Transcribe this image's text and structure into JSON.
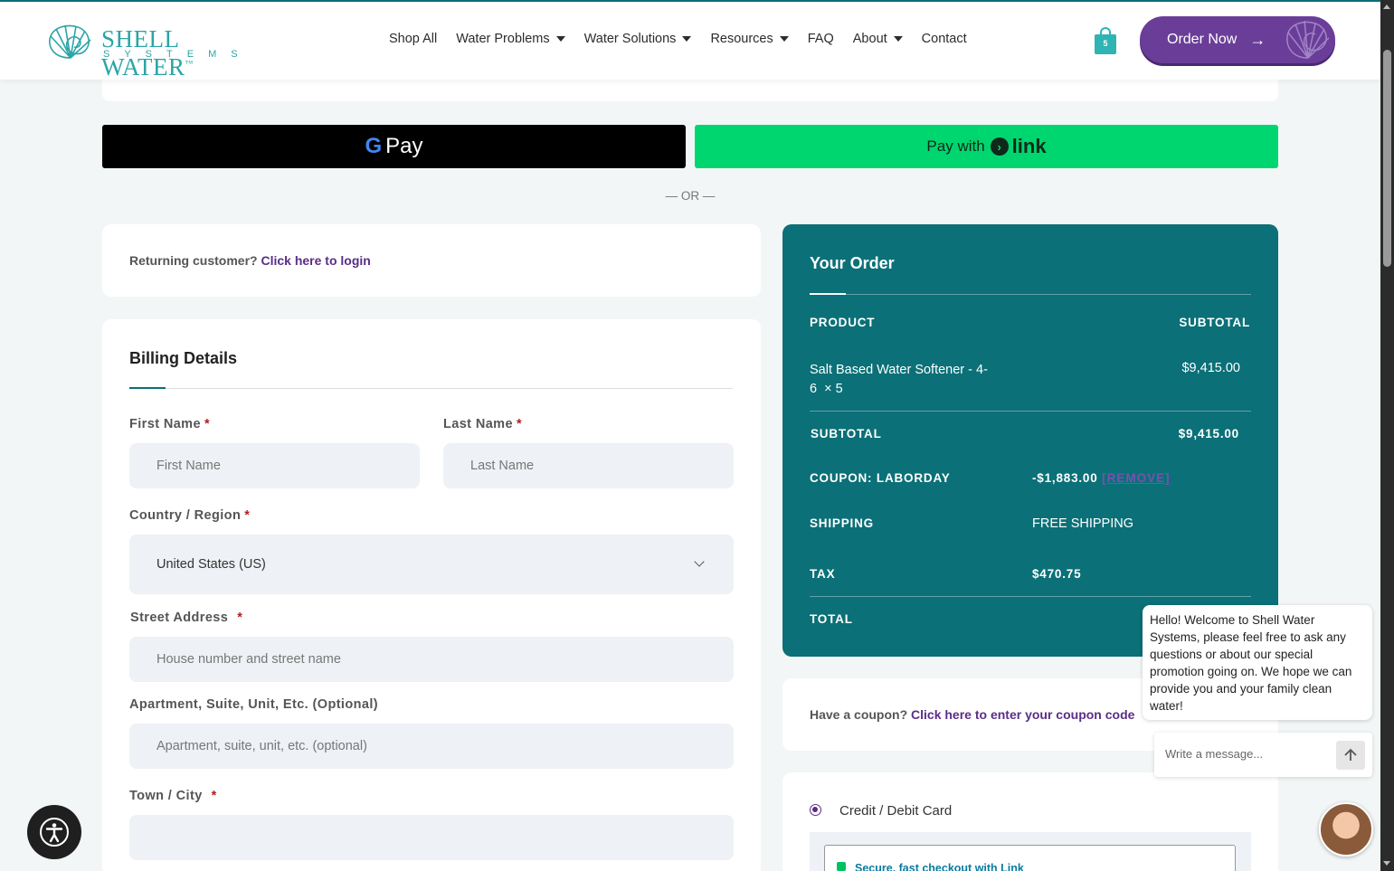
{
  "brand": {
    "name": "SHELL WATER",
    "tm": "™",
    "sub": "SYSTEMS"
  },
  "nav": [
    {
      "label": "Shop All",
      "has_dropdown": false
    },
    {
      "label": "Water Problems",
      "has_dropdown": true
    },
    {
      "label": "Water Solutions",
      "has_dropdown": true
    },
    {
      "label": "Resources",
      "has_dropdown": true
    },
    {
      "label": "FAQ",
      "has_dropdown": false
    },
    {
      "label": "About",
      "has_dropdown": true
    },
    {
      "label": "Contact",
      "has_dropdown": false
    }
  ],
  "cart": {
    "count": "5",
    "icon": "shopping-bag-icon"
  },
  "order_now": {
    "label": "Order Now",
    "icon": "arrow-right-icon"
  },
  "express": {
    "gpay_g": "G",
    "gpay_label": "Pay",
    "link_prefix": "Pay with",
    "link_icon": "›",
    "link_word": "link",
    "or_text": "— OR —"
  },
  "returning": {
    "text": "Returning customer?",
    "link": "Click here to login"
  },
  "billing": {
    "title": "Billing Details",
    "first_name": {
      "label": "First Name",
      "placeholder": "First Name",
      "required": "*"
    },
    "last_name": {
      "label": "Last Name",
      "placeholder": "Last Name",
      "required": "*"
    },
    "country": {
      "label": "Country / Region",
      "value": "United States (US)",
      "required": "*"
    },
    "street": {
      "label": "Street Address",
      "placeholder": "House number and street name",
      "required": "*"
    },
    "apartment": {
      "label": "Apartment, Suite, Unit, Etc. (Optional)",
      "placeholder": "Apartment, suite, unit, etc. (optional)"
    },
    "city": {
      "label": "Town / City",
      "placeholder": "",
      "required": "*"
    }
  },
  "order": {
    "title": "Your Order",
    "col_product": "PRODUCT",
    "col_subtotal": "SUBTOTAL",
    "item_name_line1": "Salt Based Water Softener - 4-",
    "item_name_line2": "6",
    "item_qty": "× 5",
    "item_price": "$9,415.00",
    "subtotal_label": "SUBTOTAL",
    "subtotal_value": "$9,415.00",
    "coupon_label": "COUPON: LABORDAY",
    "coupon_value": "-$1,883.00",
    "coupon_remove": "[REMOVE]",
    "shipping_label": "SHIPPING",
    "shipping_value": "FREE SHIPPING",
    "tax_label": "TAX",
    "tax_value": "$470.75",
    "total_label": "TOTAL"
  },
  "coupon": {
    "text": "Have a coupon?",
    "link": "Click here to enter your coupon code"
  },
  "payment": {
    "method": "Credit / Debit Card",
    "secure_text": "Secure, fast checkout with Link"
  },
  "chat": {
    "message": "Hello! Welcome to Shell Water Systems, please feel free to ask any questions or about our special promotion going on. We hope we can provide you and your family clean water!",
    "placeholder": "Write a message...",
    "send_icon": "arrow-up-icon"
  },
  "colors": {
    "teal": "#0b7077",
    "purple": "#6a3e98",
    "link_green": "#00d66f"
  }
}
